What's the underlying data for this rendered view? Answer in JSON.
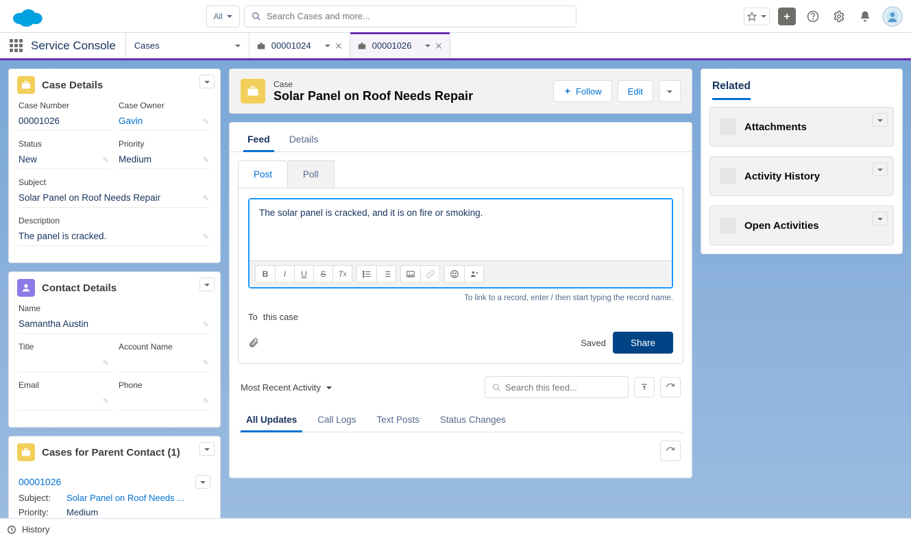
{
  "header": {
    "scope_label": "All",
    "search_placeholder": "Search Cases and more..."
  },
  "nav": {
    "app_name": "Service Console",
    "object_tab": "Cases",
    "tabs": [
      {
        "label": "00001024",
        "active": false
      },
      {
        "label": "00001026",
        "active": true
      }
    ]
  },
  "highlights": {
    "object_label": "Case",
    "title": "Solar Panel on Roof Needs Repair",
    "follow_label": "Follow",
    "edit_label": "Edit"
  },
  "center_tabs": {
    "feed": "Feed",
    "details": "Details"
  },
  "publisher": {
    "post_tab": "Post",
    "poll_tab": "Poll",
    "post_text": "The solar panel is cracked, and it is on fire or smoking.",
    "hint": "To link to a record, enter / then start typing the record name.",
    "to_label": "To",
    "to_value": "this case",
    "saved_label": "Saved",
    "share_label": "Share"
  },
  "feed_filter": {
    "label": "Most Recent Activity",
    "search_placeholder": "Search this feed..."
  },
  "feed_tabs": {
    "all": "All Updates",
    "call": "Call Logs",
    "text": "Text Posts",
    "status": "Status Changes"
  },
  "case_details": {
    "title": "Case Details",
    "case_number_label": "Case Number",
    "case_number": "00001026",
    "owner_label": "Case Owner",
    "owner": "Gavin",
    "status_label": "Status",
    "status": "New",
    "priority_label": "Priority",
    "priority": "Medium",
    "subject_label": "Subject",
    "subject": "Solar Panel on Roof Needs Repair",
    "description_label": "Description",
    "description": "The panel is cracked."
  },
  "contact_details": {
    "title": "Contact Details",
    "name_label": "Name",
    "name": "Samantha Austin",
    "title_label": "Title",
    "account_label": "Account Name",
    "email_label": "Email",
    "phone_label": "Phone"
  },
  "parent_cases": {
    "title": "Cases for Parent Contact (1)",
    "items": [
      {
        "number": "00001026",
        "subject_label": "Subject:",
        "subject": "Solar Panel on Roof Needs ...",
        "priority_label": "Priority:",
        "priority": "Medium"
      }
    ]
  },
  "related": {
    "title": "Related",
    "cards": [
      {
        "label": "Attachments"
      },
      {
        "label": "Activity History"
      },
      {
        "label": "Open Activities"
      }
    ]
  },
  "utility": {
    "history": "History"
  }
}
